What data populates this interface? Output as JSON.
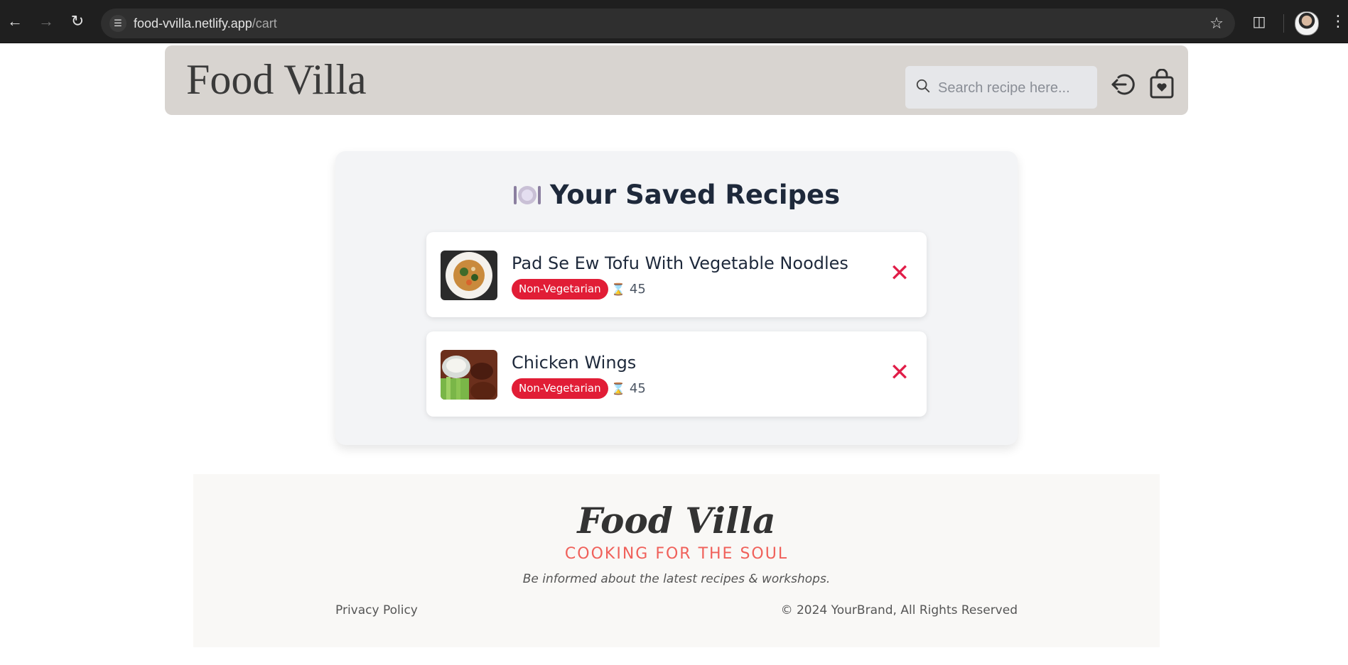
{
  "browser": {
    "url_host": "food-vvilla.netlify.app",
    "url_path": "/cart"
  },
  "header": {
    "brand": "Food Villa",
    "search_placeholder": "Search recipe here..."
  },
  "saved": {
    "title": "Your Saved Recipes",
    "items": [
      {
        "name": "Pad Se Ew Tofu With Vegetable Noodles",
        "badge": "Non-Vegetarian",
        "time": "45",
        "remove": "✕"
      },
      {
        "name": "Chicken Wings",
        "badge": "Non-Vegetarian",
        "time": "45",
        "remove": "✕"
      }
    ]
  },
  "footer": {
    "brand": "Food Villa",
    "tagline": "COOKING FOR THE SOUL",
    "note": "Be informed about the latest recipes & workshops.",
    "privacy": "Privacy Policy",
    "copyright": "© 2024 YourBrand, All Rights Reserved"
  },
  "colors": {
    "header_bg": "#d8d4d0",
    "badge": "#e11d36",
    "remove": "#e11d48",
    "tagline": "#f0605a"
  }
}
